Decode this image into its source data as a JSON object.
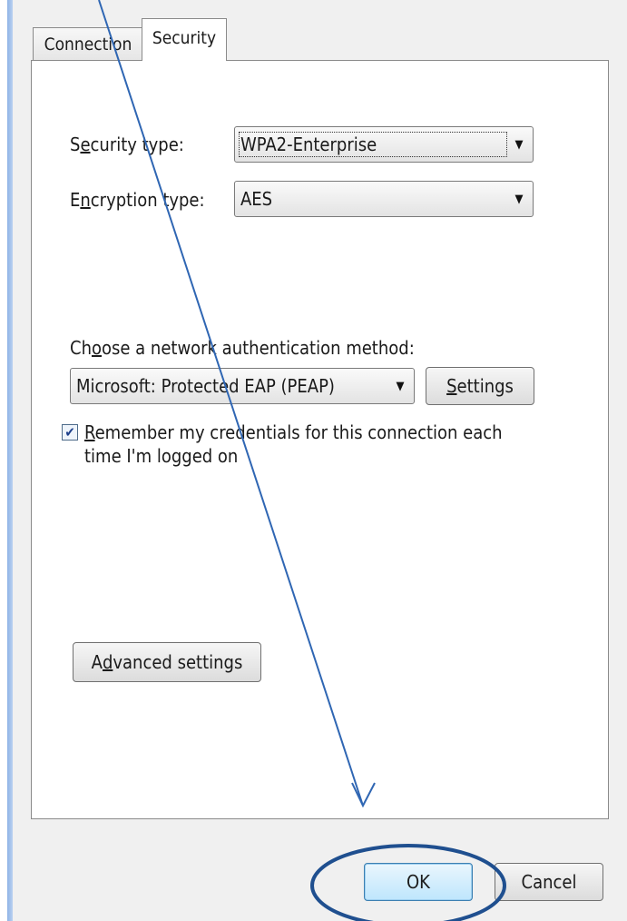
{
  "tabs": [
    {
      "label": "Connection"
    },
    {
      "label": "Security",
      "active": true
    }
  ],
  "security": {
    "security_type": {
      "label_pre": "S",
      "label_mnemonic": "e",
      "label_post": "curity type:",
      "value": "WPA2-Enterprise"
    },
    "encryption_type": {
      "label_pre": "E",
      "label_mnemonic": "n",
      "label_post": "cryption type:",
      "value": "AES"
    },
    "auth": {
      "label_pre": "Ch",
      "label_mnemonic": "o",
      "label_post": "ose a network authentication method:",
      "method": "Microsoft: Protected EAP (PEAP)",
      "settings_mnemonic": "S",
      "settings_rest": "ettings"
    },
    "remember": {
      "checked": true,
      "mnemonic": "R",
      "text_rest": "emember my credentials for this connection each",
      "text_line2": "time I'm logged on"
    },
    "advanced": {
      "pre": "A",
      "mnemonic": "d",
      "post": "vanced settings"
    }
  },
  "footer": {
    "ok_label": "OK",
    "cancel_label": "Cancel"
  },
  "annotation": {
    "color": "#2f66b3",
    "highlight_color": "#1f4f8f"
  },
  "icons": {
    "dropdown": "chevron-down-icon",
    "check": "checkmark-icon"
  }
}
